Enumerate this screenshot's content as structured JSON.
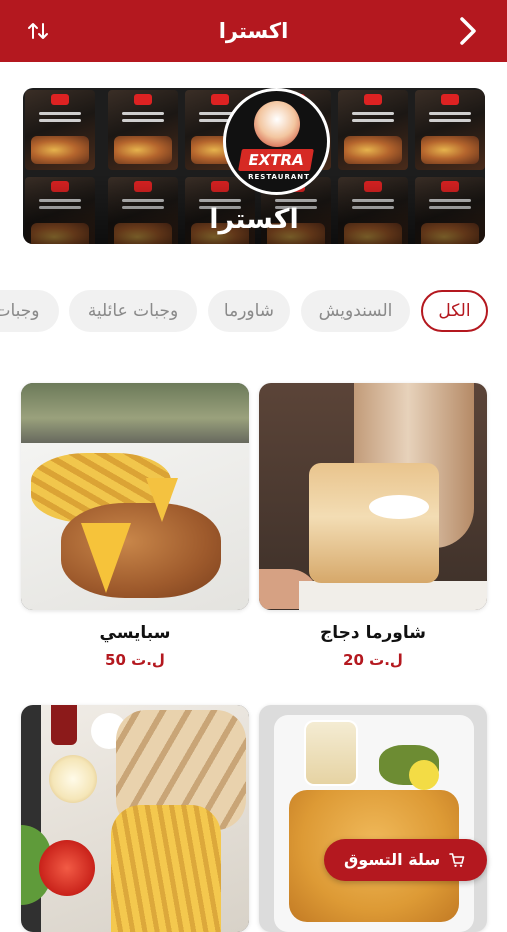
{
  "header": {
    "title": "اكسترا",
    "sort_icon": "sort-arrows-icon",
    "back_icon": "chevron-right-icon",
    "background": "#b4181f"
  },
  "banner": {
    "restaurant_name": "اكسترا",
    "logo_text": "EXTRA",
    "logo_subtext": "RESTAURANT"
  },
  "categories": [
    {
      "label": "الكل",
      "active": true
    },
    {
      "label": "السندويش",
      "active": false
    },
    {
      "label": "شاورما",
      "active": false
    },
    {
      "label": "وجبات عائلية",
      "active": false
    },
    {
      "label": "وجبات",
      "active": false
    }
  ],
  "products": [
    {
      "name": "شاورما دجاج",
      "price": "20 ل.ت"
    },
    {
      "name": "سبايسي",
      "price": "50 ل.ت"
    },
    {
      "name": "",
      "price": ""
    },
    {
      "name": "",
      "price": ""
    }
  ],
  "cart": {
    "label": "سلة التسوق",
    "icon": "cart-icon"
  },
  "colors": {
    "accent": "#b4181f",
    "chip_bg": "#f1f1f1",
    "chip_text": "#8a8a8a"
  }
}
